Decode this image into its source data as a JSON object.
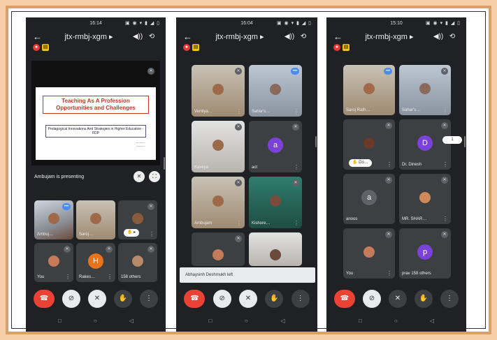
{
  "phones": [
    {
      "time": "16:14",
      "meeting": "jtx-rmbj-xgm",
      "presentation": {
        "title_line1": "Teaching As A Profession",
        "title_line2": "Opportunities and Challenges",
        "subtitle": "Pedagogical Innovations And Strategies in Higher Education - FDP",
        "presenting_text": "Ambujam is presenting"
      },
      "tiles": [
        "Ambuj…",
        "Saroj…",
        "You",
        "Rakes…",
        "158 others"
      ],
      "avatar_letters": {
        "h": "H"
      }
    },
    {
      "time": "16:04",
      "meeting": "jtx-rmbj-xgm",
      "tiles": [
        "Ventiya…",
        "Sahar's…",
        "Kaveya",
        "act",
        "Ambujam",
        "Kishore…"
      ],
      "avatar_letters": {
        "a": "a"
      },
      "toast": "Abhaysinh Deshmukh left"
    },
    {
      "time": "15:10",
      "meeting": "jtx-rmbj-xgm",
      "tiles": [
        "Saroj Rath…",
        "Sahar's…",
        "Do…",
        "Dr. Dinesh",
        "anoos",
        "MR. SHAR…",
        "You",
        "prav",
        "158 others"
      ],
      "avatar_letters": {
        "d": "D",
        "a": "a",
        "p": "p"
      },
      "pill": "1"
    }
  ],
  "colors": {
    "screen_bg": "#202124",
    "tile_bg": "#3c4043",
    "hangup": "#ea4335",
    "avatar_purple": "#7b42d9",
    "avatar_orange": "#e8731a",
    "speaking": "#4a8bf5"
  },
  "icons": {
    "back": "←",
    "chevron": "▸",
    "speaker": "🔊",
    "switch_camera": "⟲",
    "mic_off": "🎙",
    "more": "⋮",
    "hand": "✋",
    "cam_off": "⊘",
    "square": "□",
    "circle": "○",
    "triangle": "◁"
  }
}
